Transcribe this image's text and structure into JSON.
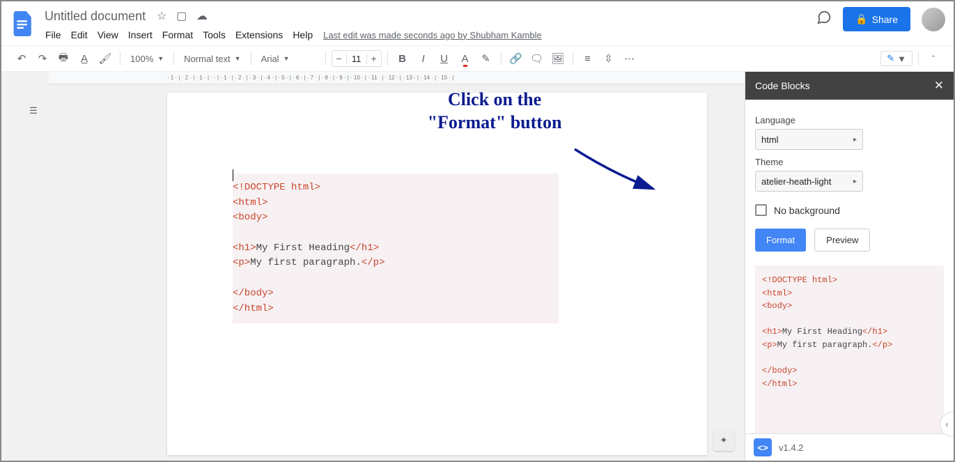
{
  "header": {
    "doc_title": "Untitled document",
    "last_edit": "Last edit was made seconds ago by Shubham Kamble",
    "share_label": "Share"
  },
  "menus": {
    "file": "File",
    "edit": "Edit",
    "view": "View",
    "insert": "Insert",
    "format": "Format",
    "tools": "Tools",
    "extensions": "Extensions",
    "help": "Help"
  },
  "toolbar": {
    "zoom": "100%",
    "style": "Normal text",
    "font": "Arial",
    "size": "11"
  },
  "ruler": "· 1 · | · 2 · | · 1 · | · · | · 1 · | · 2 · | · 3 · | · 4 · | · 5 · | · 6 · | · 7 · | · 8 · | · 9 · | · 10 · | · 11 · | · 12 · | · 13 · | · 14 · | · 15 · |",
  "document": {
    "code_html": "<!DOCTYPE html>\n<html>\n<body>\n\n<h1>My First Heading</h1>\n<p>My first paragraph.</p>\n\n</body>\n</html>"
  },
  "annotation": {
    "line1": "Click on the",
    "line2": "\"Format\" button"
  },
  "sidebar": {
    "title": "Code Blocks",
    "language_label": "Language",
    "language_value": "html",
    "theme_label": "Theme",
    "theme_value": "atelier-heath-light",
    "no_bg_label": "No background",
    "format_btn": "Format",
    "preview_btn": "Preview",
    "preview_html": "<!DOCTYPE html>\n<html>\n<body>\n\n<h1>My First Heading</h1>\n<p>My first paragraph.</p>\n\n</body>\n</html>",
    "version": "v1.4.2"
  }
}
